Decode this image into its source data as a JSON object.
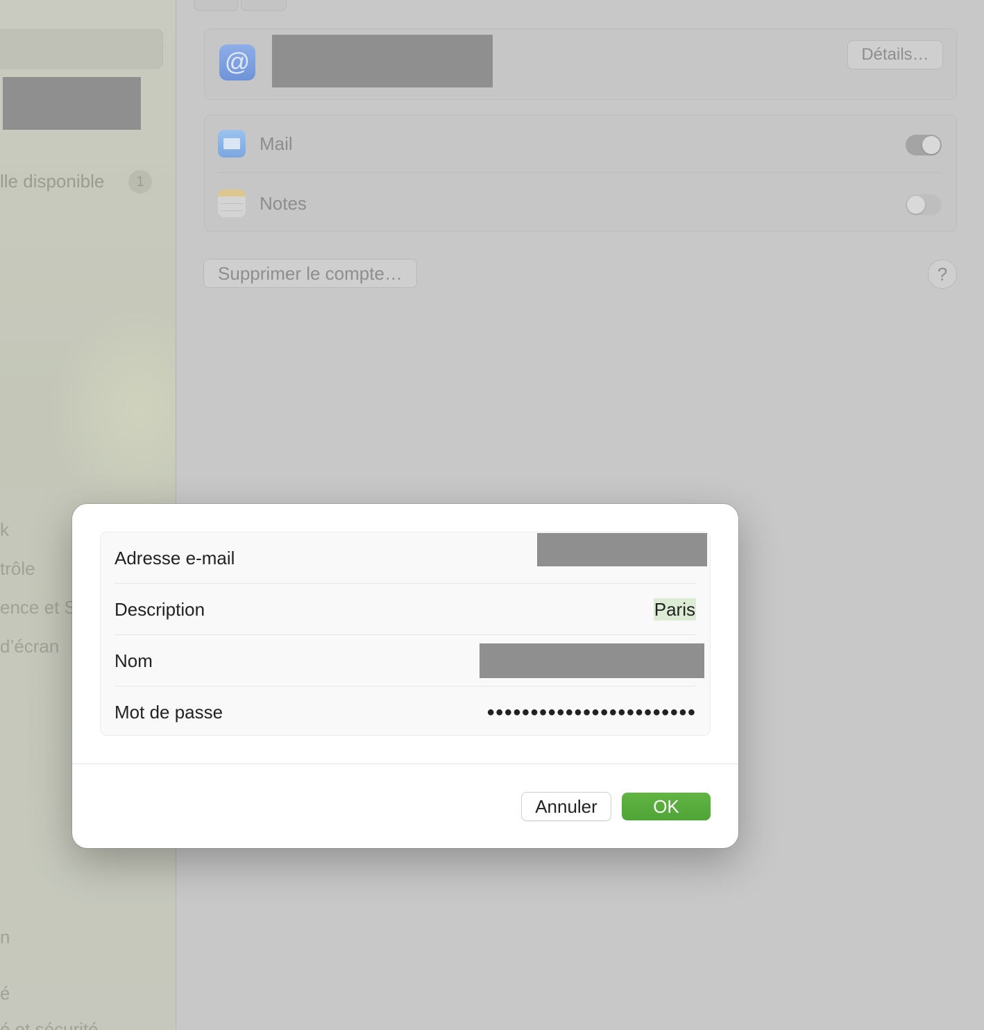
{
  "sidebar": {
    "update_label": "lle disponible",
    "update_badge": "1",
    "items": [
      "k",
      "trôle",
      "ence et Si",
      "d’écran",
      "n",
      "é",
      "é et sécurité"
    ]
  },
  "account": {
    "details_button": "Détails…",
    "at_icon_glyph": "@",
    "apps": [
      {
        "label": "Mail",
        "enabled": true
      },
      {
        "label": "Notes",
        "enabled": false
      }
    ],
    "delete_button": "Supprimer le compte…",
    "help_button": "?"
  },
  "sheet": {
    "fields": {
      "email": {
        "label": "Adresse e-mail"
      },
      "description": {
        "label": "Description",
        "value": "Paris"
      },
      "name": {
        "label": "Nom"
      },
      "password": {
        "label": "Mot de passe",
        "value": "●●●●●●●●●●●●●●●●●●●●●●●●"
      }
    },
    "cancel_button": "Annuler",
    "ok_button": "OK"
  },
  "colors": {
    "ok_accent": "#55ab3b",
    "selection_highlight": "#dcebd3"
  }
}
